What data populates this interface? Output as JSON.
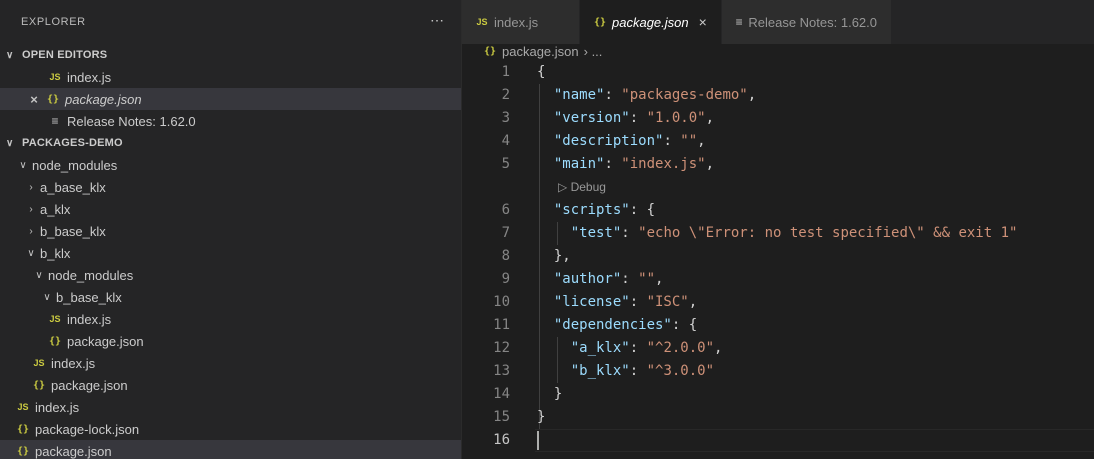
{
  "sidebar": {
    "title": "EXPLORER",
    "more_icon": "⋯",
    "open_editors": {
      "label": "OPEN EDITORS",
      "items": [
        {
          "name": "index.js",
          "icon": "JS"
        },
        {
          "name": "package.json",
          "icon": "{}"
        },
        {
          "name": "Release Notes: 1.62.0",
          "icon": "≡"
        }
      ]
    },
    "project": {
      "label": "PACKAGES-DEMO",
      "tree": [
        {
          "label": "node_modules"
        },
        {
          "label": "a_base_klx"
        },
        {
          "label": "a_klx"
        },
        {
          "label": "b_base_klx"
        },
        {
          "label": "b_klx"
        },
        {
          "label": "node_modules"
        },
        {
          "label": "b_base_klx"
        },
        {
          "label": "index.js",
          "icon": "JS"
        },
        {
          "label": "package.json",
          "icon": "{}"
        },
        {
          "label": "index.js",
          "icon": "JS"
        },
        {
          "label": "package.json",
          "icon": "{}"
        },
        {
          "label": "index.js",
          "icon": "JS"
        },
        {
          "label": "package-lock.json",
          "icon": "{}"
        },
        {
          "label": "package.json",
          "icon": "{}"
        }
      ]
    }
  },
  "tabs": [
    {
      "label": "index.js",
      "icon": "JS"
    },
    {
      "label": "package.json",
      "icon": "{}",
      "close": "×"
    },
    {
      "label": "Release Notes: 1.62.0",
      "icon": "≡"
    }
  ],
  "breadcrumb": {
    "file": "package.json",
    "rest": "› ..."
  },
  "codelens": "▷ Debug",
  "line_numbers": [
    "1",
    "2",
    "3",
    "4",
    "5",
    "6",
    "7",
    "8",
    "9",
    "10",
    "11",
    "12",
    "13",
    "14",
    "15",
    "16"
  ]
}
